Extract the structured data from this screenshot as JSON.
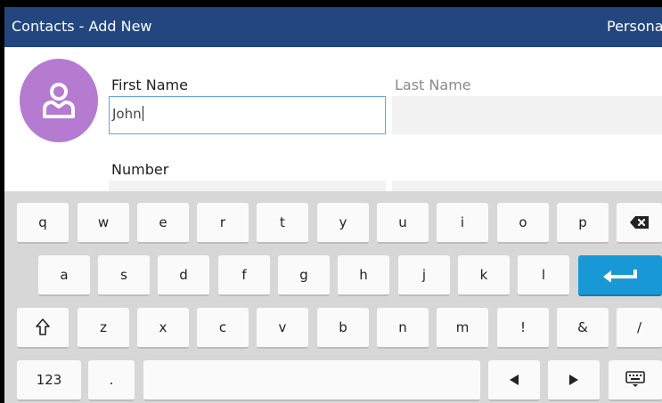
{
  "header": {
    "title": "Contacts - Add New",
    "tab_label": "Personal"
  },
  "form": {
    "first_name": {
      "label": "First Name",
      "value": "John"
    },
    "last_name": {
      "label": "Last Name",
      "value": ""
    },
    "number": {
      "label": "Number",
      "value": ""
    }
  },
  "keyboard": {
    "row1": [
      "q",
      "w",
      "e",
      "r",
      "t",
      "y",
      "u",
      "i",
      "o",
      "p"
    ],
    "row2": [
      "a",
      "s",
      "d",
      "f",
      "g",
      "h",
      "j",
      "k",
      "l"
    ],
    "row3": [
      "z",
      "x",
      "c",
      "v",
      "b",
      "n",
      "m",
      "!",
      "&",
      "/"
    ],
    "numbers_label": "123",
    "period_label": ".",
    "icons": {
      "backspace": "backspace-icon",
      "enter": "enter-icon",
      "shift": "shift-icon",
      "left": "left-arrow-icon",
      "right": "right-arrow-icon",
      "hide": "keyboard-icon"
    },
    "accent_color": "#1899d6"
  },
  "colors": {
    "title_bar": "#23467f",
    "avatar": "#b47bd1",
    "focus_border": "#5fa7d8"
  }
}
